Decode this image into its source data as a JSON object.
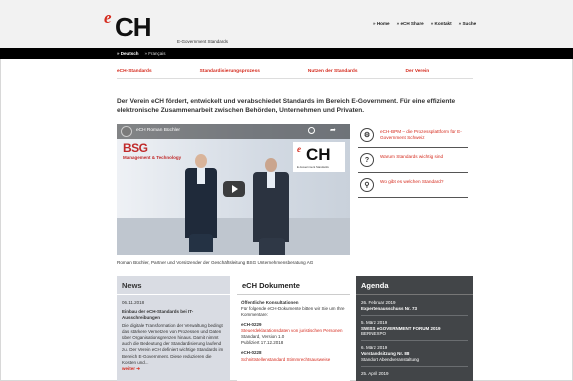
{
  "brand": {
    "logo_e": "e",
    "logo_ch": "CH",
    "tagline": "E-Government Standards",
    "accent_color": "#d52b1e"
  },
  "topnav": [
    "» Home",
    "» eCH Share",
    "» Kontakt",
    "» Suche"
  ],
  "languages": {
    "active": "» Deutsch",
    "other": "» Français"
  },
  "mainnav": [
    "eCH-Standards",
    "Standardisierungsprozess",
    "Nutzen der Standards",
    "Der Verein"
  ],
  "intro": "Der Verein eCH fördert, entwickelt und verabschiedet Standards im Bereich E-Government. Für eine effiziente elektronische Zusammenarbeit zwischen Behörden, Unternehmen und Privaten.",
  "video": {
    "title": "eCH Roman Büchler",
    "brand_text": "BSG",
    "brand_sub": "Management & Technology",
    "overlay_logo_e": "e",
    "overlay_logo_ch": "CH",
    "overlay_logo_tag": "E-Government Standards",
    "caption": "Roman Büchler, Partner und Vorsitzender der Geschäftsleitung BSG Unternehmensberatung AG"
  },
  "sidelinks": [
    {
      "icon": "bpm-icon",
      "glyph": "⚙",
      "label": "eCH-BPM – die Prozessplattform für E-Government Schweiz"
    },
    {
      "icon": "question-icon",
      "glyph": "?",
      "label": "Warum Standards wichtig sind"
    },
    {
      "icon": "search-icon",
      "glyph": "⚲",
      "label": "Wo gibt es welchen Standard?"
    }
  ],
  "news": {
    "heading": "News",
    "date": "06.11.2018",
    "title": "Einbau der eCH-Standards bei IT-Ausschreibungen",
    "text": "Die digitale Transformation der Verwaltung bedingt das stärkere Vernetzen von Prozessen und Daten über Organisationsgrenzen hinaus. Damit nimmt auch die Bedeutung der Standardisierung laufend zu. Der Verein eCH definiert wichtige Standards im Bereich E-Government. Diese reduzieren die Kosten und...",
    "more": "weiter ➔"
  },
  "docs": {
    "heading": "eCH Dokumente",
    "consult_title": "Öffentliche Konsultationen",
    "consult_text": "Für folgende eCH-Dokumente bitten wir Sie um Ihre Kommentare:",
    "items": [
      {
        "id": "eCH-0229",
        "title": "Steuerdeklarationsdaten von juristischen Personen",
        "version": "Standard, Version 1.0",
        "published": "Publiziert 17.12.2018"
      },
      {
        "id": "eCH-0228",
        "title": "Schnittstellenstandard Stimmrechtsausweise"
      }
    ]
  },
  "agenda": {
    "heading": "Agenda",
    "items": [
      {
        "date": "26. Februar 2019",
        "title": "Expertenausschuss Nr. 73",
        "sub": ""
      },
      {
        "date": "5. März 2019",
        "title": "SWISS eGOVERNMENT FORUM 2019",
        "sub": "BERNEXPO"
      },
      {
        "date": "6. März 2019",
        "title": "Vorstandsitzung Nr. 88",
        "sub": "Standort Abendveranstaltung"
      },
      {
        "date": "25. April 2019",
        "title": "",
        "sub": ""
      }
    ]
  }
}
